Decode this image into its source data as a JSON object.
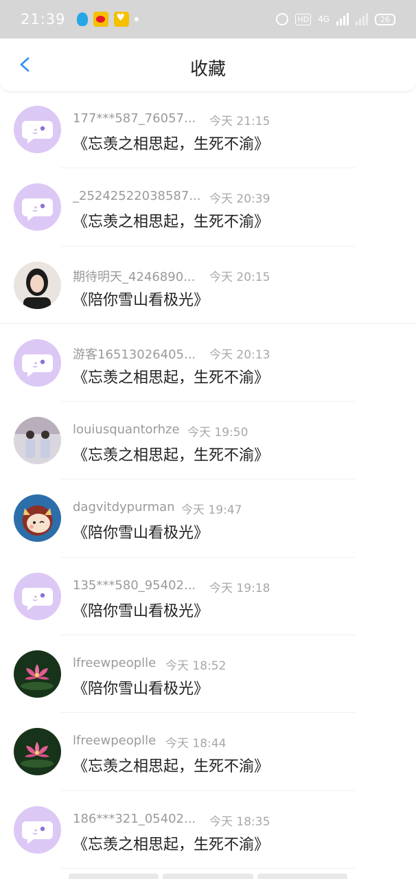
{
  "status_bar": {
    "time": "21:39",
    "hd_label": "HD",
    "network_label": "4G",
    "battery_level": "26"
  },
  "header": {
    "title": "收藏"
  },
  "favorites": [
    {
      "name": "177***587_76057...",
      "time": "今天 21:15",
      "title": "《忘羡之相思起，生死不渝》",
      "avatar": "default-chat-avatar"
    },
    {
      "name": "_25242522038587...",
      "time": "今天 20:39",
      "title": "《忘羡之相思起，生死不渝》",
      "avatar": "default-chat-avatar"
    },
    {
      "name": "期待明天_4246890...",
      "time": "今天 20:15",
      "title": "《陪你雪山看极光》",
      "avatar": "girl-photo-avatar"
    },
    {
      "name": "游客16513026405...",
      "time": "今天 20:13",
      "title": "《忘羡之相思起，生死不渝》",
      "avatar": "default-chat-avatar"
    },
    {
      "name": "louiusquantorhze",
      "time": "今天 19:50",
      "title": "《忘羡之相思起，生死不渝》",
      "avatar": "group-photo-avatar"
    },
    {
      "name": "dagvitdypurman",
      "time": "今天 19:47",
      "title": "《陪你雪山看极光》",
      "avatar": "cartoon-avatar"
    },
    {
      "name": "135***580_95402...",
      "time": "今天 19:18",
      "title": "《陪你雪山看极光》",
      "avatar": "default-chat-avatar"
    },
    {
      "name": "lfreewpeoplle",
      "time": "今天 18:52",
      "title": "《陪你雪山看极光》",
      "avatar": "lotus-photo-avatar"
    },
    {
      "name": "lfreewpeoplle",
      "time": "今天 18:44",
      "title": "《忘羡之相思起，生死不渝》",
      "avatar": "lotus-photo-avatar"
    },
    {
      "name": "186***321_05402...",
      "time": "今天 18:35",
      "title": "《忘羡之相思起，生死不渝》",
      "avatar": "default-chat-avatar"
    }
  ],
  "colors": {
    "accent": "#2e8ef0",
    "default_avatar_bg": "#dcc8f5",
    "name_text": "#9a9a9a",
    "title_text": "#222222"
  }
}
